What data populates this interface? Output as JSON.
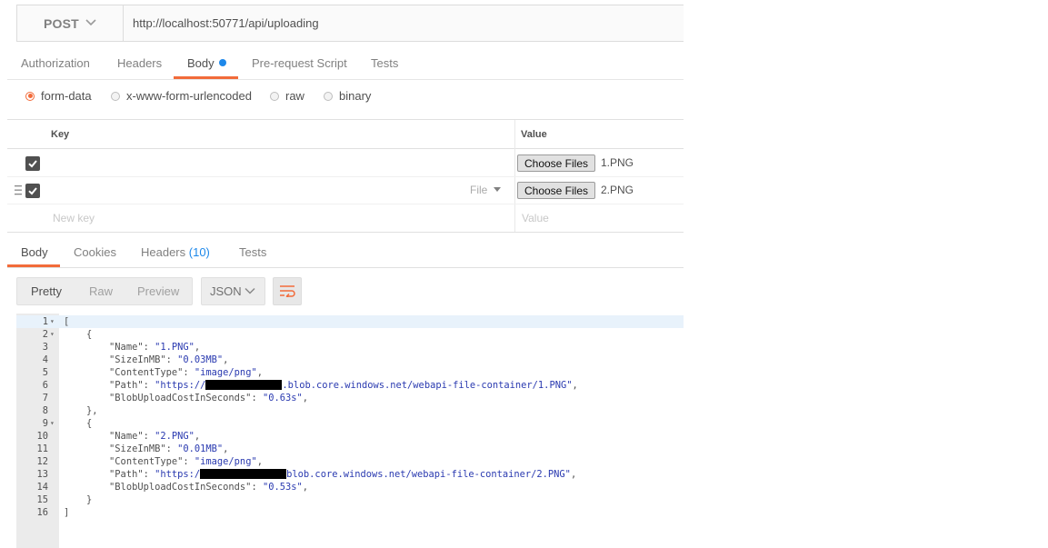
{
  "request": {
    "method": "POST",
    "url": "http://localhost:50771/api/uploading"
  },
  "request_tabs": {
    "authorization": "Authorization",
    "headers": "Headers",
    "body": "Body",
    "prerequest": "Pre-request Script",
    "tests": "Tests"
  },
  "body_types": {
    "form_data": "form-data",
    "urlencoded": "x-www-form-urlencoded",
    "raw": "raw",
    "binary": "binary"
  },
  "form_table": {
    "key_header": "Key",
    "value_header": "Value",
    "rows": [
      {
        "button": "Choose Files",
        "file": "1.PNG"
      },
      {
        "button": "Choose Files",
        "file": "2.PNG",
        "type": "File"
      }
    ],
    "new_key_placeholder": "New key",
    "value_placeholder": "Value"
  },
  "response_tabs": {
    "body": "Body",
    "cookies": "Cookies",
    "headers": "Headers",
    "headers_count": "(10)",
    "tests": "Tests"
  },
  "response_toolbar": {
    "pretty": "Pretty",
    "raw": "Raw",
    "preview": "Preview",
    "format": "JSON"
  },
  "code": {
    "lines": [
      {
        "n": "1",
        "text": "["
      },
      {
        "n": "2",
        "text": "    {"
      },
      {
        "n": "3",
        "key": "\"Name\"",
        "val": "\"1.PNG\""
      },
      {
        "n": "4",
        "key": "\"SizeInMB\"",
        "val": "\"0.03MB\""
      },
      {
        "n": "5",
        "key": "\"ContentType\"",
        "val": "\"image/png\""
      },
      {
        "n": "6",
        "key": "\"Path\"",
        "val_pre": "\"https://",
        "val_post": ".blob.core.windows.net/webapi-file-container/1.PNG\""
      },
      {
        "n": "7",
        "key": "\"BlobUploadCostInSeconds\"",
        "val": "\"0.63s\""
      },
      {
        "n": "8",
        "text": "    },"
      },
      {
        "n": "9",
        "text": "    {"
      },
      {
        "n": "10",
        "key": "\"Name\"",
        "val": "\"2.PNG\""
      },
      {
        "n": "11",
        "key": "\"SizeInMB\"",
        "val": "\"0.01MB\""
      },
      {
        "n": "12",
        "key": "\"ContentType\"",
        "val": "\"image/png\""
      },
      {
        "n": "13",
        "key": "\"Path\"",
        "val_pre": "\"https:/",
        "val_post": "blob.core.windows.net/webapi-file-container/2.PNG\""
      },
      {
        "n": "14",
        "key": "\"BlobUploadCostInSeconds\"",
        "val": "\"0.53s\""
      },
      {
        "n": "15",
        "text": "    }"
      },
      {
        "n": "16",
        "text": "]"
      }
    ]
  },
  "colors": {
    "accent": "#f26b3a",
    "link_blue": "#1d88ea",
    "string_blue": "#2a3ab0"
  }
}
